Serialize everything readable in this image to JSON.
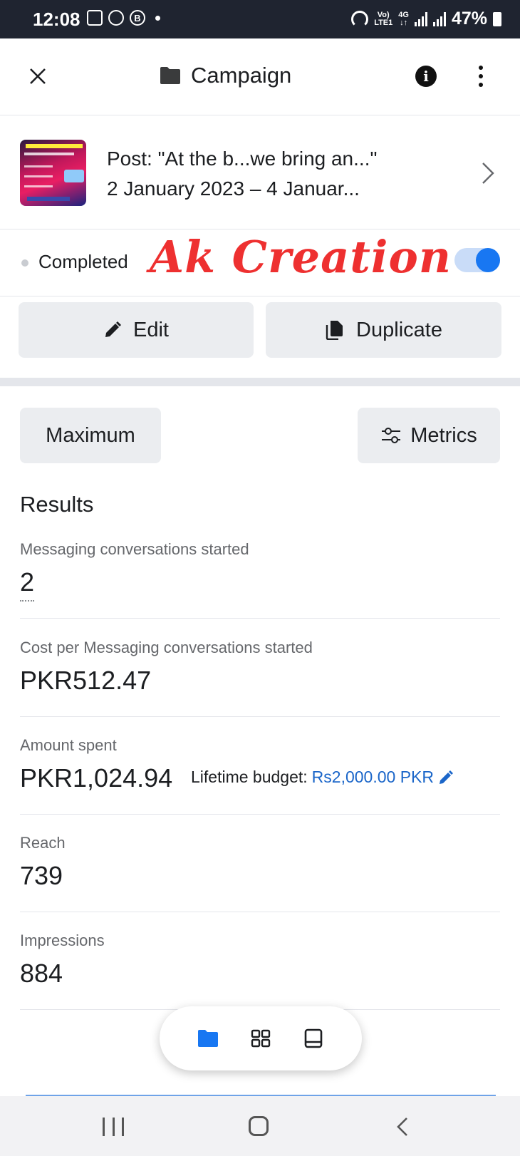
{
  "status_bar": {
    "time": "12:08",
    "network_top": "Vo)",
    "network_bottom": "LTE1",
    "net_type_top": "4G",
    "net_type_bottom": "↓↑",
    "battery": "47%"
  },
  "header": {
    "title": "Campaign",
    "icons": [
      "close-icon",
      "folder-icon",
      "info-icon",
      "more-icon"
    ]
  },
  "post": {
    "title": "Post: \"At the b...we bring an...\"",
    "dates": "2 January 2023 – 4 Januar..."
  },
  "status": {
    "label": "Completed",
    "watermark": "Ak Creation",
    "toggle_on": true
  },
  "actions": {
    "edit_label": "Edit",
    "duplicate_label": "Duplicate"
  },
  "controls": {
    "maximum_label": "Maximum",
    "metrics_label": "Metrics"
  },
  "results": {
    "heading": "Results",
    "messaging_label": "Messaging conversations started",
    "messaging_value": "2",
    "cost_label": "Cost per Messaging conversations started",
    "cost_value": "PKR512.47",
    "spent_label": "Amount spent",
    "spent_value": "PKR1,024.94",
    "budget_label": "Lifetime budget:",
    "budget_value": "Rs2,000.00 PKR",
    "reach_label": "Reach",
    "reach_value": "739",
    "impressions_label": "Impressions",
    "impressions_value": "884"
  },
  "colors": {
    "accent": "#1877f2",
    "link": "#1b66c9",
    "watermark": "#ee3030",
    "statusbar": "#1f2430"
  }
}
